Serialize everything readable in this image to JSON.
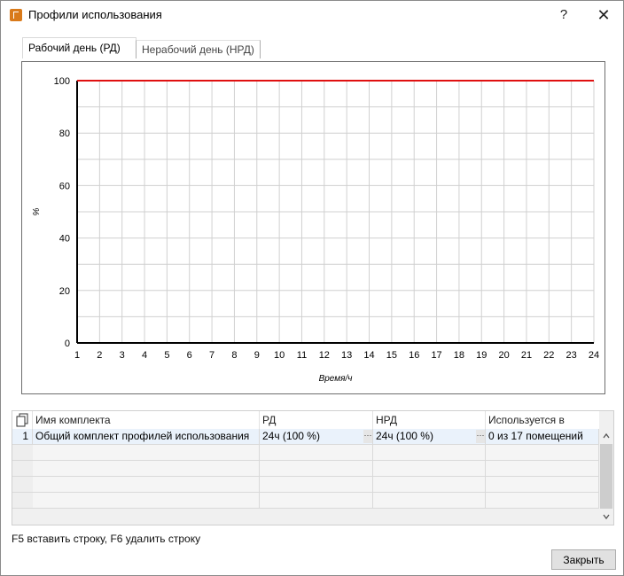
{
  "window": {
    "title": "Профили использования",
    "help_label": "?",
    "close_label": "✕"
  },
  "tabs": [
    {
      "label": "Рабочий день (РД)",
      "active": true
    },
    {
      "label": "Нерабочий день (НРД)",
      "active": false
    }
  ],
  "chart_data": {
    "type": "line",
    "title": "",
    "xlabel": "Время/ч",
    "ylabel": "%",
    "xlim": [
      1,
      24
    ],
    "ylim": [
      0,
      100
    ],
    "x_ticks": [
      1,
      2,
      3,
      4,
      5,
      6,
      7,
      8,
      9,
      10,
      11,
      12,
      13,
      14,
      15,
      16,
      17,
      18,
      19,
      20,
      21,
      22,
      23,
      24
    ],
    "y_ticks": [
      0,
      20,
      40,
      60,
      80,
      100
    ],
    "grid": true,
    "series": [
      {
        "x": [
          1,
          24
        ],
        "values": [
          100,
          100
        ],
        "color": "#e01010"
      }
    ]
  },
  "table": {
    "columns": [
      "Имя комплекта",
      "РД",
      "НРД",
      "Используется в"
    ],
    "rows": [
      {
        "num": "1",
        "name": "Общий комплект профилей использования",
        "rd": "24ч (100 %)",
        "nrd": "24ч (100 %)",
        "used": "0 из 17 помещений"
      }
    ],
    "empty_rows": 4,
    "ellipsis": "···"
  },
  "hint": "F5 вставить строку, F6 удалить строку",
  "buttons": {
    "close": "Закрыть"
  },
  "icons": {
    "app": "app-icon",
    "copy": "copy-icon",
    "scroll_up": "chevron-up-icon",
    "scroll_down": "chevron-down-icon"
  }
}
